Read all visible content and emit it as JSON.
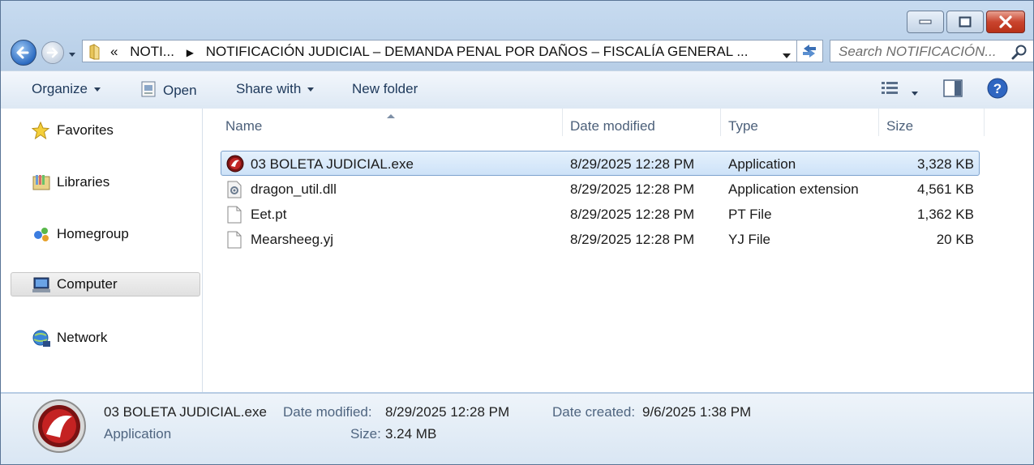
{
  "address": {
    "crumbs": [
      "«",
      "NOTI...",
      "NOTIFICACIÓN JUDICIAL – DEMANDA PENAL POR DAÑOS – FISCALÍA GENERAL ..."
    ]
  },
  "search": {
    "placeholder": "Search NOTIFICACIÓN..."
  },
  "toolbar": {
    "organize": "Organize",
    "open": "Open",
    "share_with": "Share with",
    "new_folder": "New folder"
  },
  "nav": [
    {
      "label": "Favorites",
      "icon": "star-icon"
    },
    {
      "label": "Libraries",
      "icon": "libraries-icon"
    },
    {
      "label": "Homegroup",
      "icon": "homegroup-icon"
    },
    {
      "label": "Computer",
      "icon": "computer-icon",
      "selected": true
    },
    {
      "label": "Network",
      "icon": "network-icon"
    }
  ],
  "columns": {
    "name": "Name",
    "date": "Date modified",
    "type": "Type",
    "size": "Size"
  },
  "files": [
    {
      "name": "03 BOLETA JUDICIAL.exe",
      "date": "8/29/2025 12:28 PM",
      "type": "Application",
      "size": "3,328 KB",
      "icon": "dragon-app-icon",
      "selected": true
    },
    {
      "name": "dragon_util.dll",
      "date": "8/29/2025 12:28 PM",
      "type": "Application extension",
      "size": "4,561 KB",
      "icon": "dll-file-icon"
    },
    {
      "name": "Eet.pt",
      "date": "8/29/2025 12:28 PM",
      "type": "PT File",
      "size": "1,362 KB",
      "icon": "blank-file-icon"
    },
    {
      "name": "Mearsheeg.yj",
      "date": "8/29/2025 12:28 PM",
      "type": "YJ File",
      "size": "20 KB",
      "icon": "blank-file-icon"
    }
  ],
  "details": {
    "name": "03 BOLETA JUDICIAL.exe",
    "kind": "Application",
    "date_modified_label": "Date modified:",
    "date_modified": "8/29/2025 12:28 PM",
    "date_created_label": "Date created:",
    "date_created": "9/6/2025 1:38 PM",
    "size_label": "Size:",
    "size": "3.24 MB"
  }
}
